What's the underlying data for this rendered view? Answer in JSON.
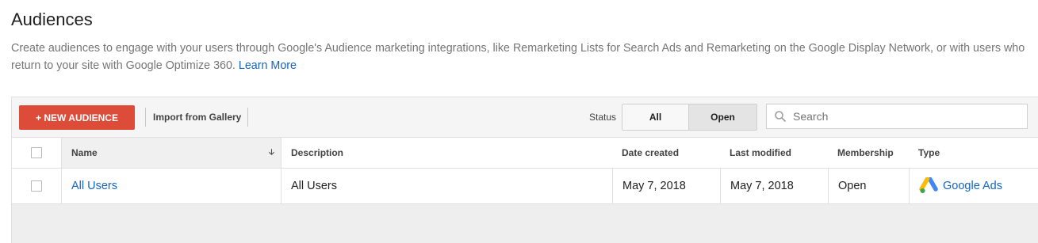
{
  "page": {
    "title": "Audiences",
    "description": "Create audiences to engage with your users through Google's Audience marketing integrations, like Remarketing Lists for Search Ads and Remarketing on the Google Display Network, or with users who return to your site with Google Optimize 360.",
    "learn_more": "Learn More"
  },
  "toolbar": {
    "new_audience": "+ NEW AUDIENCE",
    "import_gallery": "Import from Gallery",
    "status_label": "Status",
    "status_options": [
      "All",
      "Open"
    ],
    "status_selected": "Open",
    "search_placeholder": "Search"
  },
  "table": {
    "columns": [
      "Name",
      "Description",
      "Date created",
      "Last modified",
      "Membership",
      "Type"
    ],
    "rows": [
      {
        "name": "All Users",
        "description": "All Users",
        "date_created": "May 7, 2018",
        "last_modified": "May 7, 2018",
        "membership": "Open",
        "type": "Google Ads"
      }
    ]
  },
  "colors": {
    "primary_button": "#dd4b39",
    "link": "#1565c0",
    "google_ads_blue": "#4285f4",
    "google_ads_yellow": "#fbbc04",
    "google_ads_green": "#34a853"
  },
  "icons": {
    "search": "search-icon",
    "sort": "sort-down-icon",
    "type": "google-ads-icon"
  }
}
